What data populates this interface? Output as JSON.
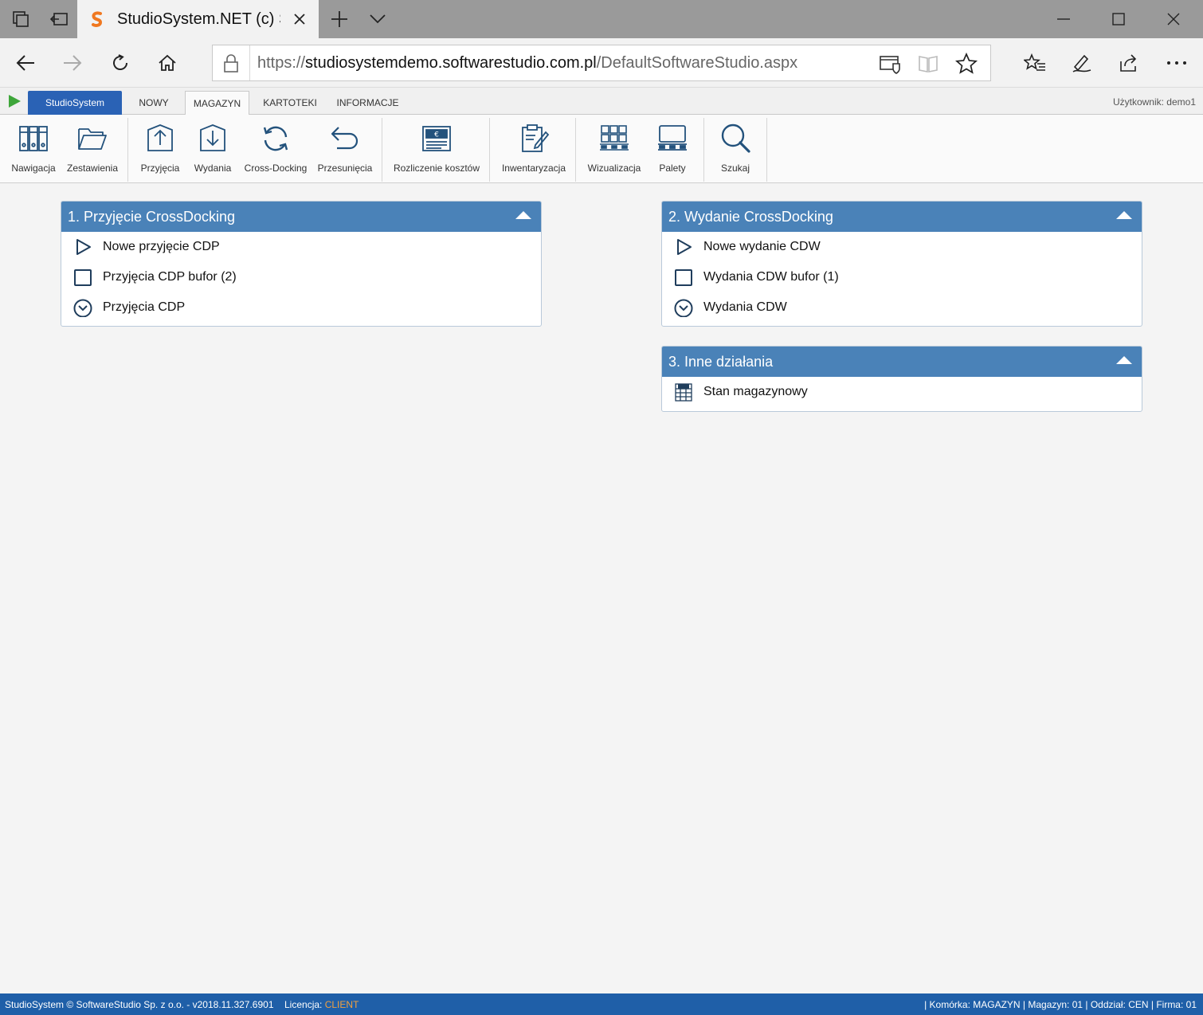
{
  "browser": {
    "tab_title": "StudioSystem.NET (c) Sc",
    "url_prefix": "https://",
    "url_host": "studiosystemdemo.softwarestudio.com.pl",
    "url_path": "/DefaultSoftwareStudio.aspx"
  },
  "app": {
    "brand_tab": "StudioSystem",
    "tabs": [
      {
        "label": "NOWY"
      },
      {
        "label": "MAGAZYN"
      },
      {
        "label": "KARTOTEKI"
      },
      {
        "label": "INFORMACJE"
      }
    ],
    "active_tab": "MAGAZYN",
    "user": "Użytkownik: demo1"
  },
  "toolbar": {
    "items": [
      {
        "label": "Nawigacja",
        "icon": "binders-icon"
      },
      {
        "label": "Zestawienia",
        "icon": "folder-icon"
      },
      {
        "label": "Przyjęcia",
        "icon": "inbound-icon"
      },
      {
        "label": "Wydania",
        "icon": "outbound-icon"
      },
      {
        "label": "Cross-Docking",
        "icon": "cycle-icon"
      },
      {
        "label": "Przesunięcia",
        "icon": "undo-arrow-icon"
      },
      {
        "label": "Rozliczenie kosztów",
        "icon": "invoice-icon"
      },
      {
        "label": "Inwentaryzacja",
        "icon": "clipboard-pen-icon"
      },
      {
        "label": "Wizualizacja",
        "icon": "pallet-boxes-icon"
      },
      {
        "label": "Palety",
        "icon": "pallet-icon"
      },
      {
        "label": "Szukaj",
        "icon": "magnifier-icon"
      }
    ]
  },
  "panels": {
    "p1": {
      "title": "1. Przyjęcie CrossDocking",
      "items": [
        {
          "label": "Nowe przyjęcie CDP",
          "icon": "play-outline-icon"
        },
        {
          "label": "Przyjęcia CDP bufor (2)",
          "icon": "checkbox-icon"
        },
        {
          "label": "Przyjęcia CDP",
          "icon": "circle-chevron-down-icon"
        }
      ]
    },
    "p2": {
      "title": "2. Wydanie CrossDocking",
      "items": [
        {
          "label": "Nowe wydanie CDW",
          "icon": "play-outline-icon"
        },
        {
          "label": "Wydania CDW bufor (1)",
          "icon": "checkbox-icon"
        },
        {
          "label": "Wydania CDW",
          "icon": "circle-chevron-down-icon"
        }
      ]
    },
    "p3": {
      "title": "3. Inne działania",
      "items": [
        {
          "label": "Stan magazynowy",
          "icon": "xls-sheet-icon"
        }
      ]
    }
  },
  "status": {
    "left": "StudioSystem © SoftwareStudio Sp. z o.o. - v2018.11.327.6901",
    "license_label": "Licencja:",
    "license_value": "CLIENT",
    "right": "| Komórka: MAGAZYN | Magazyn: 01 | Oddział: CEN | Firma: 01"
  },
  "colors": {
    "panel_header": "#4a82b8",
    "brand_tab": "#2a62b5",
    "status_bar": "#1f5fa8",
    "license_value": "#f0a040"
  }
}
